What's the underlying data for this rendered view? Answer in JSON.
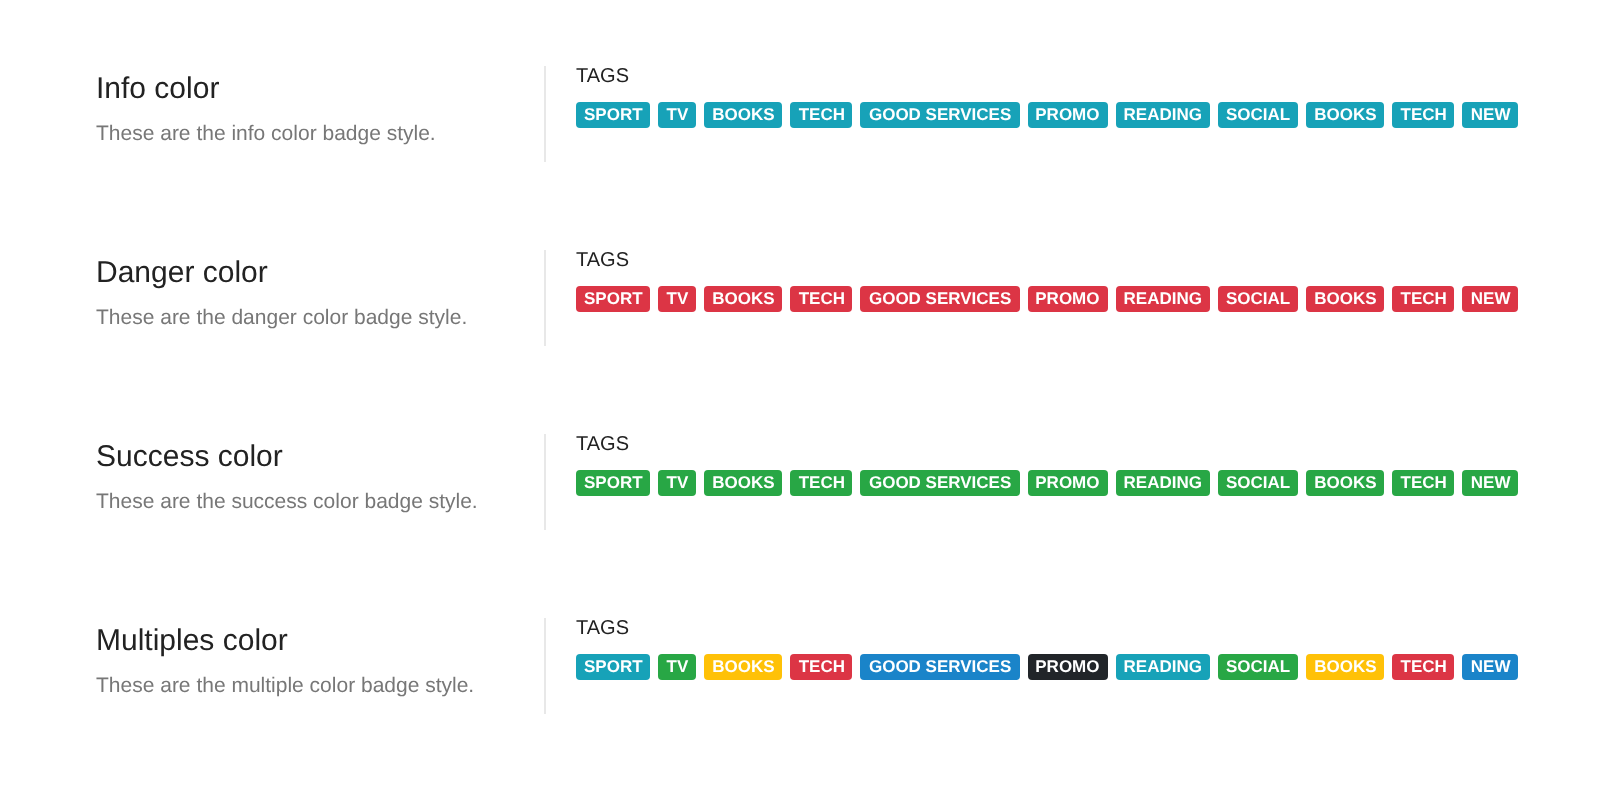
{
  "sections": [
    {
      "title": "Info color",
      "description": "These are the info color badge style.",
      "tags_label": "TAGS",
      "tags": [
        {
          "text": "SPORT",
          "color": "#17a2b8"
        },
        {
          "text": "TV",
          "color": "#17a2b8"
        },
        {
          "text": "BOOKS",
          "color": "#17a2b8"
        },
        {
          "text": "TECH",
          "color": "#17a2b8"
        },
        {
          "text": "GOOD SERVICES",
          "color": "#17a2b8"
        },
        {
          "text": "PROMO",
          "color": "#17a2b8"
        },
        {
          "text": "READING",
          "color": "#17a2b8"
        },
        {
          "text": "SOCIAL",
          "color": "#17a2b8"
        },
        {
          "text": "BOOKS",
          "color": "#17a2b8"
        },
        {
          "text": "TECH",
          "color": "#17a2b8"
        },
        {
          "text": "NEW",
          "color": "#17a2b8"
        }
      ]
    },
    {
      "title": "Danger color",
      "description": "These are the danger color badge style.",
      "tags_label": "TAGS",
      "tags": [
        {
          "text": "SPORT",
          "color": "#dc3545"
        },
        {
          "text": "TV",
          "color": "#dc3545"
        },
        {
          "text": "BOOKS",
          "color": "#dc3545"
        },
        {
          "text": "TECH",
          "color": "#dc3545"
        },
        {
          "text": "GOOD SERVICES",
          "color": "#dc3545"
        },
        {
          "text": "PROMO",
          "color": "#dc3545"
        },
        {
          "text": "READING",
          "color": "#dc3545"
        },
        {
          "text": "SOCIAL",
          "color": "#dc3545"
        },
        {
          "text": "BOOKS",
          "color": "#dc3545"
        },
        {
          "text": "TECH",
          "color": "#dc3545"
        },
        {
          "text": "NEW",
          "color": "#dc3545"
        }
      ]
    },
    {
      "title": "Success color",
      "description": "These are the success color badge style.",
      "tags_label": "TAGS",
      "tags": [
        {
          "text": "SPORT",
          "color": "#28a745"
        },
        {
          "text": "TV",
          "color": "#28a745"
        },
        {
          "text": "BOOKS",
          "color": "#28a745"
        },
        {
          "text": "TECH",
          "color": "#28a745"
        },
        {
          "text": "GOOD SERVICES",
          "color": "#28a745"
        },
        {
          "text": "PROMO",
          "color": "#28a745"
        },
        {
          "text": "READING",
          "color": "#28a745"
        },
        {
          "text": "SOCIAL",
          "color": "#28a745"
        },
        {
          "text": "BOOKS",
          "color": "#28a745"
        },
        {
          "text": "TECH",
          "color": "#28a745"
        },
        {
          "text": "NEW",
          "color": "#28a745"
        }
      ]
    },
    {
      "title": "Multiples color",
      "description": "These are the multiple color badge style.",
      "tags_label": "TAGS",
      "tags": [
        {
          "text": "SPORT",
          "color": "#17a2b8"
        },
        {
          "text": "TV",
          "color": "#28a745"
        },
        {
          "text": "BOOKS",
          "color": "#ffc107"
        },
        {
          "text": "TECH",
          "color": "#dc3545"
        },
        {
          "text": "GOOD SERVICES",
          "color": "#1a84c9"
        },
        {
          "text": "PROMO",
          "color": "#212529"
        },
        {
          "text": "READING",
          "color": "#17a2b8"
        },
        {
          "text": "SOCIAL",
          "color": "#28a745"
        },
        {
          "text": "BOOKS",
          "color": "#ffc107"
        },
        {
          "text": "TECH",
          "color": "#dc3545"
        },
        {
          "text": "NEW",
          "color": "#1a84c9"
        }
      ]
    }
  ]
}
